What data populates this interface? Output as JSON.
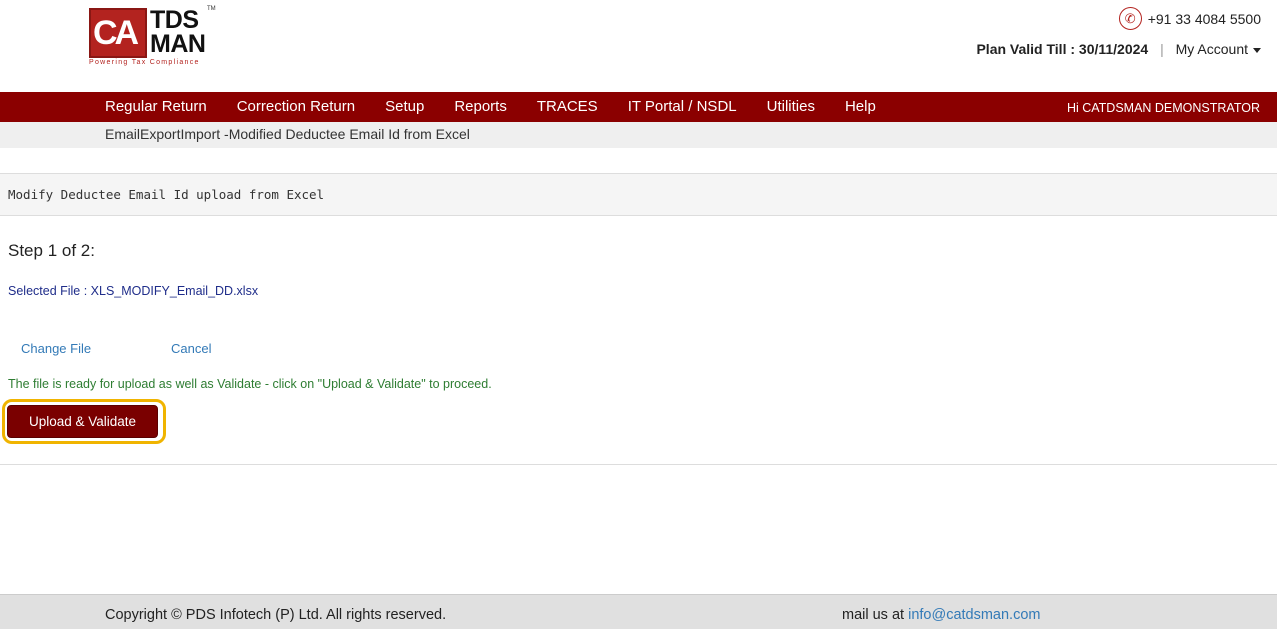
{
  "logo": {
    "mark": "CA",
    "line1": "TDS",
    "line2": "MAN",
    "trademark": "TM",
    "tagline": "Powering Tax Compliance"
  },
  "header": {
    "phone": "+91 33 4084 5500",
    "plan_label": "Plan Valid Till : 30/11/2024",
    "separator": "|",
    "account_label": "My Account"
  },
  "nav": {
    "items": [
      "Regular Return",
      "Correction Return",
      "Setup",
      "Reports",
      "TRACES",
      "IT Portal / NSDL",
      "Utilities",
      "Help"
    ],
    "user_greeting": "Hi CATDSMAN DEMONSTRATOR"
  },
  "breadcrumb": "EmailExportImport -Modified Deductee Email Id from Excel",
  "panel": {
    "title": "Modify Deductee Email Id upload from Excel",
    "step": "Step 1 of 2:",
    "selected_file": "Selected File : XLS_MODIFY_Email_DD.xlsx",
    "change_file": "Change File",
    "cancel": "Cancel",
    "ready_message": "The file is ready for upload as well as Validate - click on \"Upload & Validate\" to proceed.",
    "upload_button": "Upload & Validate"
  },
  "footer": {
    "copyright": "Copyright © PDS Infotech (P) Ltd. All rights reserved.",
    "mail_label": "mail us at ",
    "mail_email": "info@catdsman.com"
  },
  "colors": {
    "nav_bg": "#8b0000",
    "button_bg": "#7a0000",
    "highlight": "#f0b400",
    "link": "#337ab7",
    "success_text": "#2e7d32"
  }
}
